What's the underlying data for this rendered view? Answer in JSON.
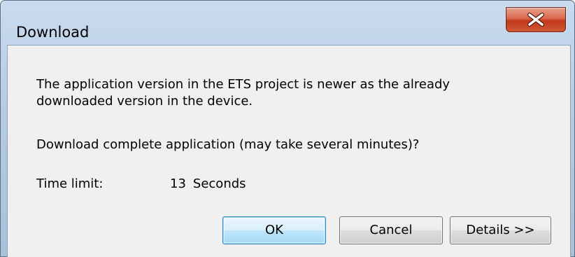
{
  "window": {
    "title": "Download"
  },
  "titlebar": {
    "close_icon": "close-x-icon"
  },
  "message": {
    "line1": "The application version in the ETS project is newer as the already",
    "line2": "downloaded version in the device.",
    "question": "Download complete application (may take several minutes)?"
  },
  "timer": {
    "label": "Time limit:",
    "value": "13",
    "unit": "Seconds"
  },
  "buttons": {
    "ok": "OK",
    "cancel": "Cancel",
    "details": "Details >>"
  },
  "colors": {
    "close_button": "#c1391b",
    "default_button_border": "#3c7fb1",
    "dialog_background": "#f0f0f0"
  }
}
